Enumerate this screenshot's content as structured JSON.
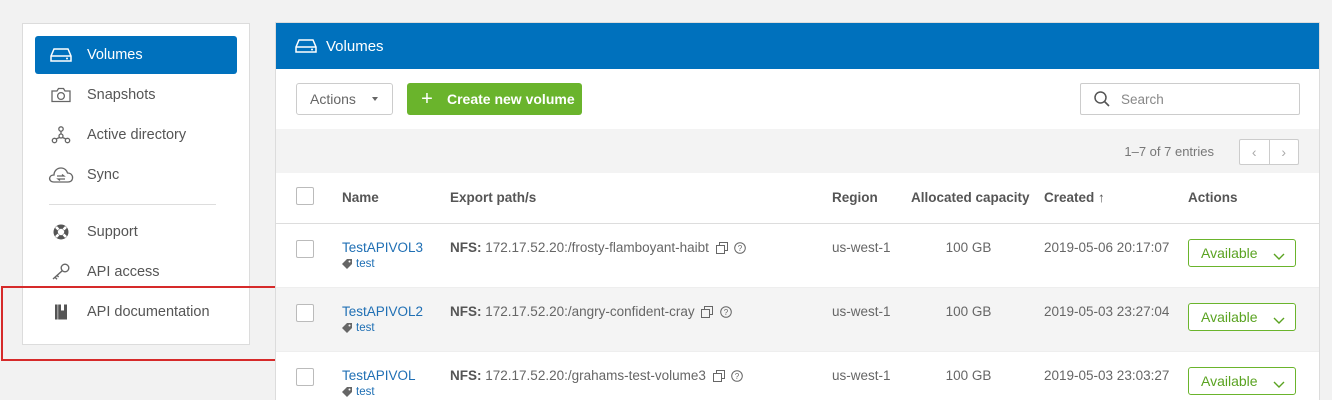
{
  "sidebar": {
    "items": [
      {
        "label": "Volumes",
        "icon": "volume-drive-icon"
      },
      {
        "label": "Snapshots",
        "icon": "camera-icon"
      },
      {
        "label": "Active directory",
        "icon": "network-tree-icon"
      },
      {
        "label": "Sync",
        "icon": "cloud-sync-icon"
      },
      {
        "label": "Support",
        "icon": "lifebuoy-icon"
      },
      {
        "label": "API access",
        "icon": "key-icon"
      },
      {
        "label": "API documentation",
        "icon": "book-icon"
      }
    ]
  },
  "panel": {
    "title": "Volumes",
    "actions_label": "Actions",
    "create_label": "Create new volume",
    "search_placeholder": "Search",
    "entries_text": "1–7 of 7 entries"
  },
  "table": {
    "headers": {
      "name": "Name",
      "path": "Export path/s",
      "region": "Region",
      "capacity": "Allocated capacity",
      "created": "Created ↑",
      "actions": "Actions"
    },
    "rows": [
      {
        "name": "TestAPIVOL3",
        "tag": "test",
        "nfs_label": "NFS:",
        "path": "172.17.52.20:/frosty-flamboyant-haibt",
        "region": "us-west-1",
        "capacity": "100 GB",
        "created": "2019-05-06 20:17:07",
        "status": "Available"
      },
      {
        "name": "TestAPIVOL2",
        "tag": "test",
        "nfs_label": "NFS:",
        "path": "172.17.52.20:/angry-confident-cray",
        "region": "us-west-1",
        "capacity": "100 GB",
        "created": "2019-05-03 23:27:04",
        "status": "Available"
      },
      {
        "name": "TestAPIVOL",
        "tag": "test",
        "nfs_label": "NFS:",
        "path": "172.17.52.20:/grahams-test-volume3",
        "region": "us-west-1",
        "capacity": "100 GB",
        "created": "2019-05-03 23:03:27",
        "status": "Available"
      }
    ]
  },
  "colors": {
    "brand_blue": "#0071bd",
    "accent_green": "#6ab42c",
    "highlight_red": "#d62a2a"
  }
}
